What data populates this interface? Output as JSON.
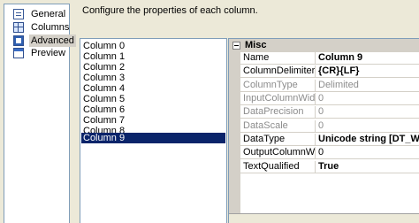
{
  "nav": {
    "items": [
      {
        "label": "General",
        "icon": "document-icon"
      },
      {
        "label": "Columns",
        "icon": "grid-icon"
      },
      {
        "label": "Advanced",
        "icon": "advanced-icon",
        "selected": true
      },
      {
        "label": "Preview",
        "icon": "preview-icon"
      }
    ]
  },
  "header": {
    "text": "Configure the properties of each column."
  },
  "columns": {
    "items": [
      "Column 0",
      "Column 1",
      "Column 2",
      "Column 3",
      "Column 4",
      "Column 5",
      "Column 6",
      "Column 7",
      "Column 8",
      "Column 9"
    ],
    "selected": "Column 9"
  },
  "properties": {
    "category": "Misc",
    "rows": [
      {
        "name": "Name",
        "value": "Column 9",
        "bold": true,
        "readonly": false
      },
      {
        "name": "ColumnDelimiter",
        "value": "{CR}{LF}",
        "bold": true,
        "readonly": false
      },
      {
        "name": "ColumnType",
        "value": "Delimited",
        "bold": false,
        "readonly": true
      },
      {
        "name": "InputColumnWidth",
        "value": "0",
        "bold": false,
        "readonly": true
      },
      {
        "name": "DataPrecision",
        "value": "0",
        "bold": false,
        "readonly": true
      },
      {
        "name": "DataScale",
        "value": "0",
        "bold": false,
        "readonly": true
      },
      {
        "name": "DataType",
        "value": "Unicode string [DT_W",
        "bold": true,
        "readonly": false
      },
      {
        "name": "OutputColumnWid",
        "value": "0",
        "bold": false,
        "readonly": false
      },
      {
        "name": "TextQualified",
        "value": "True",
        "bold": true,
        "readonly": false
      }
    ]
  },
  "colors": {
    "selection": "#0a246a",
    "panel": "#ece9d8",
    "category": "#d4d0c8",
    "readonly_text": "#8c8c8c"
  }
}
